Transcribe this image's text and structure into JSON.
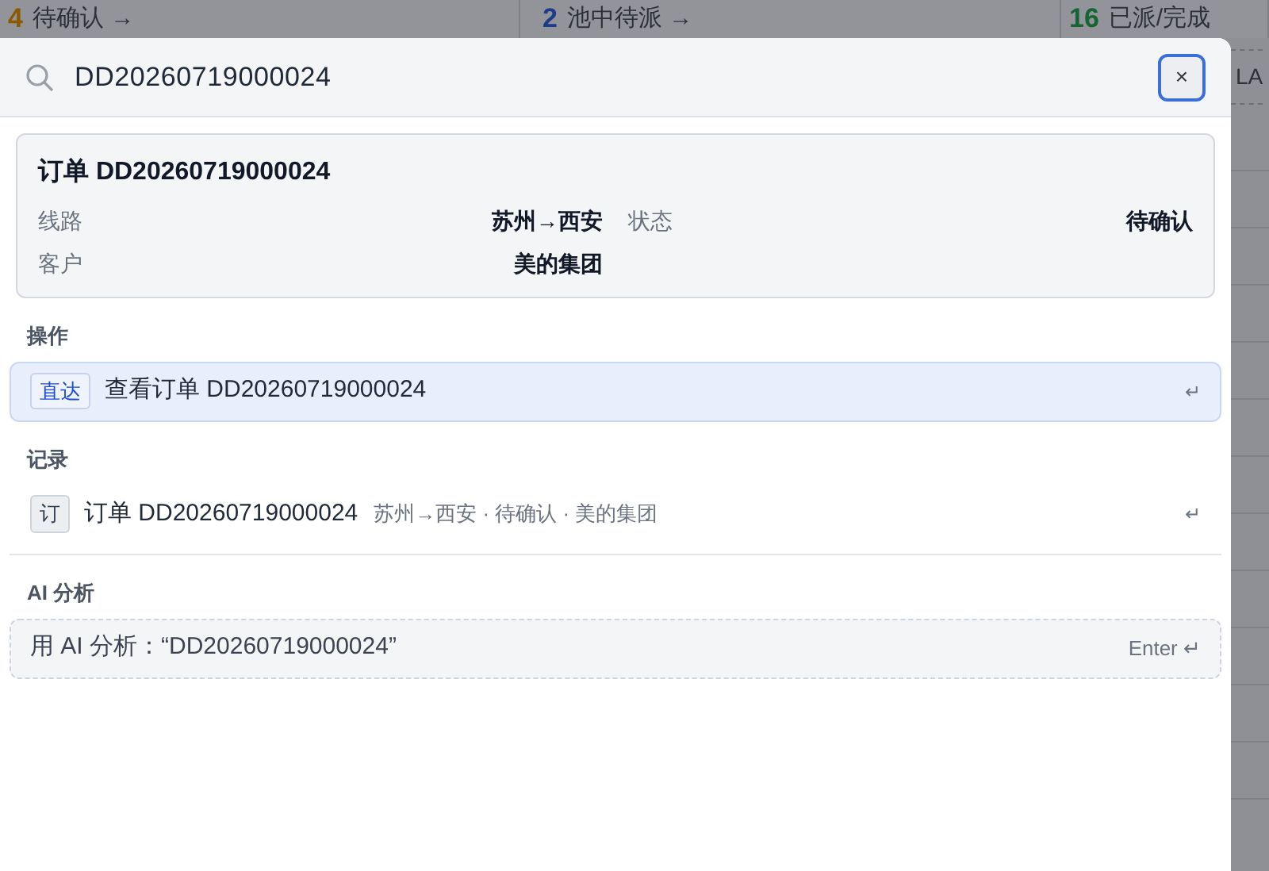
{
  "background": {
    "stats": [
      {
        "count": "4",
        "label": "待确认 →",
        "color": "#8a5a00"
      },
      {
        "count": "2",
        "label": "池中待派 →",
        "color": "#1e3a8a"
      },
      {
        "count": "16",
        "label": "已派/完成",
        "color": "#166534"
      }
    ],
    "fragment": "LA"
  },
  "search": {
    "value": "DD20260719000024",
    "close": "×"
  },
  "preview": {
    "title": "订单 DD20260719000024",
    "fields": [
      {
        "label": "线路",
        "value": "苏州→西安"
      },
      {
        "label": "状态",
        "value": "待确认"
      },
      {
        "label": "客户",
        "value": "美的集团"
      }
    ]
  },
  "sections": [
    {
      "title": "操作",
      "items": [
        {
          "kind": "action",
          "badge": "直达",
          "text": "查看订单 DD20260719000024",
          "hint": "↵",
          "selected": true
        }
      ]
    },
    {
      "title": "记录",
      "items": [
        {
          "kind": "record",
          "badge": "订",
          "text": "订单 DD20260719000024",
          "detail": "苏州→西安 · 待确认 · 美的集团",
          "hint": "↵",
          "selected": false
        }
      ]
    },
    {
      "title": "AI 分析",
      "items": [
        {
          "kind": "ai",
          "text": "用 AI 分析：“DD20260719000024”",
          "hint": "Enter ↵",
          "selected": false
        }
      ]
    }
  ]
}
